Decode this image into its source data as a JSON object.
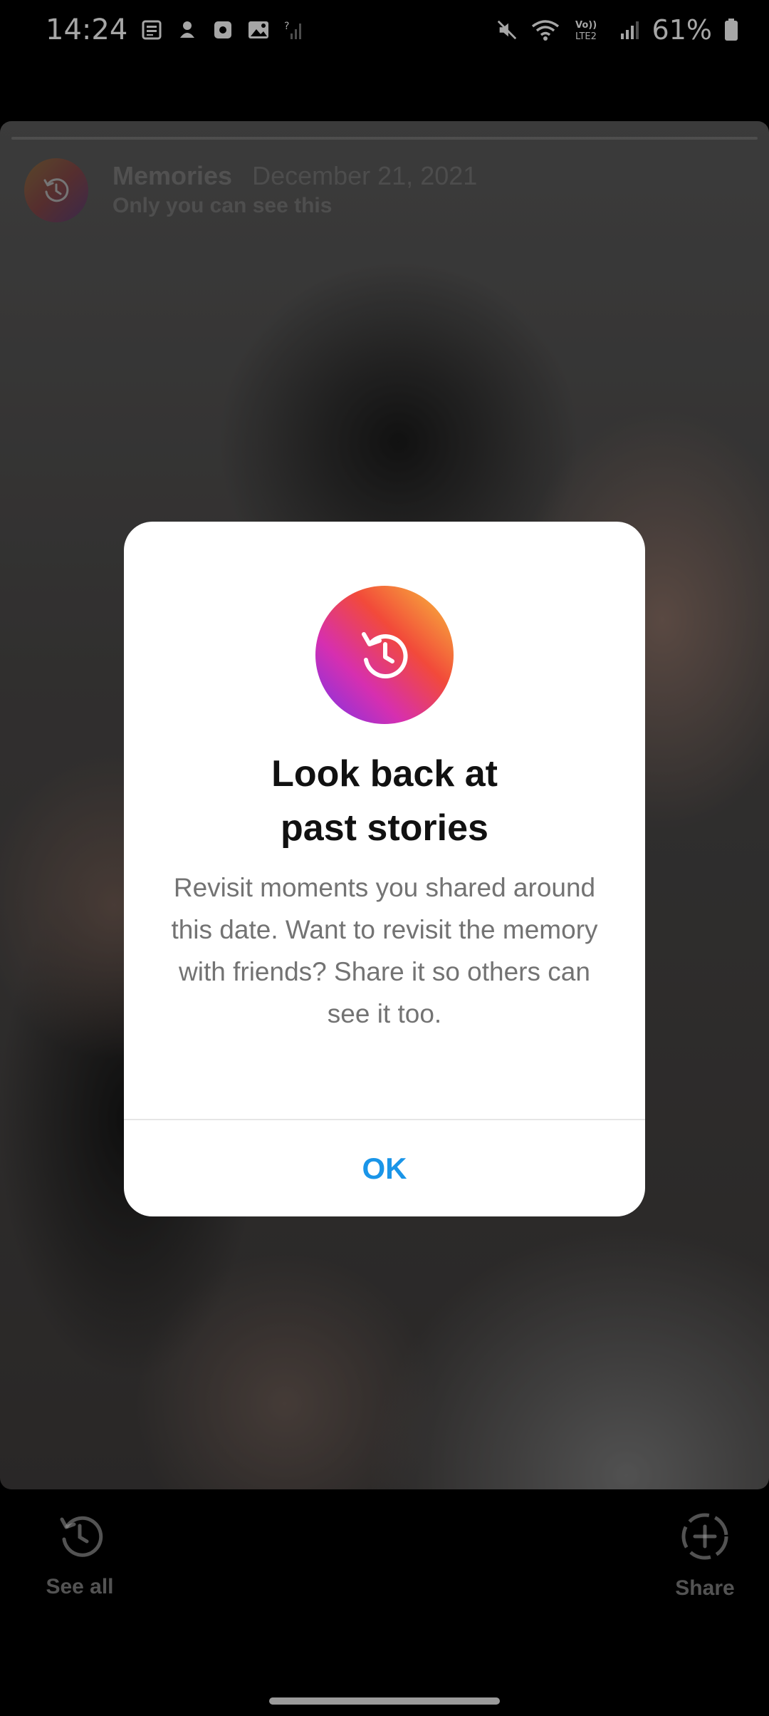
{
  "status_bar": {
    "time": "14:24",
    "battery": "61%",
    "network": "LTE2",
    "left_icons": [
      "news-icon",
      "notification-icon",
      "app-icon",
      "gallery-icon",
      "no-signal-icon"
    ],
    "right_icons": [
      "mute-icon",
      "wifi-icon",
      "volte-icon",
      "signal-icon",
      "battery-icon"
    ]
  },
  "story": {
    "title": "Memories",
    "date": "December 21, 2021",
    "subtitle": "Only you can see this"
  },
  "dialog": {
    "title_line1": "Look back at",
    "title_line2": "past stories",
    "body": "Revisit moments you shared around this date. Want to revisit the memory with friends? Share it so others can see it too.",
    "ok_label": "OK",
    "icon": "memories-history-icon",
    "accent_color": "#1a95e8"
  },
  "bottom_bar": {
    "see_all_label": "See all",
    "share_label": "Share"
  }
}
